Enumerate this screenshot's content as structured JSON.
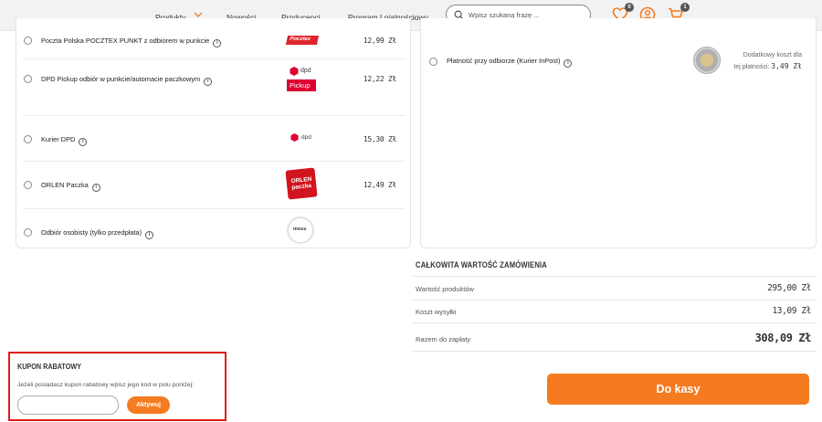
{
  "header": {
    "nav": {
      "produkty": "Produkty",
      "nowosci": "Nowości",
      "producenci": "Producenci",
      "program": "Program Lojalnościowy"
    },
    "search_placeholder": "Wpisz szukaną frazę ...",
    "wishlist_count": "0",
    "cart_count": "1",
    "accent": "#f47b20"
  },
  "shipping": [
    {
      "label": "Poczta Polska POCZTEX PUNKT z odbiorem w punkcie",
      "price": "12,99 Zł",
      "logo": "pocztex-logo"
    },
    {
      "label": "DPD Pickup odbiór w punkcie/automacie paczkowym",
      "price": "12,22 Zł",
      "logo": "dpd-pickup-logo"
    },
    {
      "label": "Kurier DPD",
      "price": "15,30 Zł",
      "logo": "dpd-logo"
    },
    {
      "label": "ORLEN Paczka",
      "price": "12,49 Zł",
      "logo": "orlen-paczka-logo"
    },
    {
      "label": "Odbiór osobisty (tylko przedpłata)",
      "price": "",
      "logo": "store-logo"
    }
  ],
  "logos": {
    "pocztex": "Pocztex",
    "dpd": "dpd",
    "pickup": "Pickup",
    "orlen": "ORLEN",
    "paczka": "paczka",
    "store": "moss"
  },
  "payment": {
    "label": "Płatność przy odbiorze (Kurier InPost)",
    "extra_line1": "Dodatkowy koszt dla",
    "extra_line2": "tej płatności:",
    "extra_price": "3,49 Zł"
  },
  "summary": {
    "title": "CAŁKOWITA WARTOŚĆ ZAMÓWIENIA",
    "products_label": "Wartość produktów",
    "products_value": "295,00 Zł",
    "shipping_label": "Koszt wysyłki",
    "shipping_value": "13,09 Zł",
    "total_label": "Razem do zapłaty",
    "total_value": "308,09 Zł",
    "checkout_label": "Do kasy"
  },
  "coupon": {
    "title": "KUPON RABATOWY",
    "text": "Jeżeli posiadasz kupon rabatowy wpisz jego kod w polu poniżej:",
    "input_value": "",
    "button_label": "Aktywuj"
  }
}
